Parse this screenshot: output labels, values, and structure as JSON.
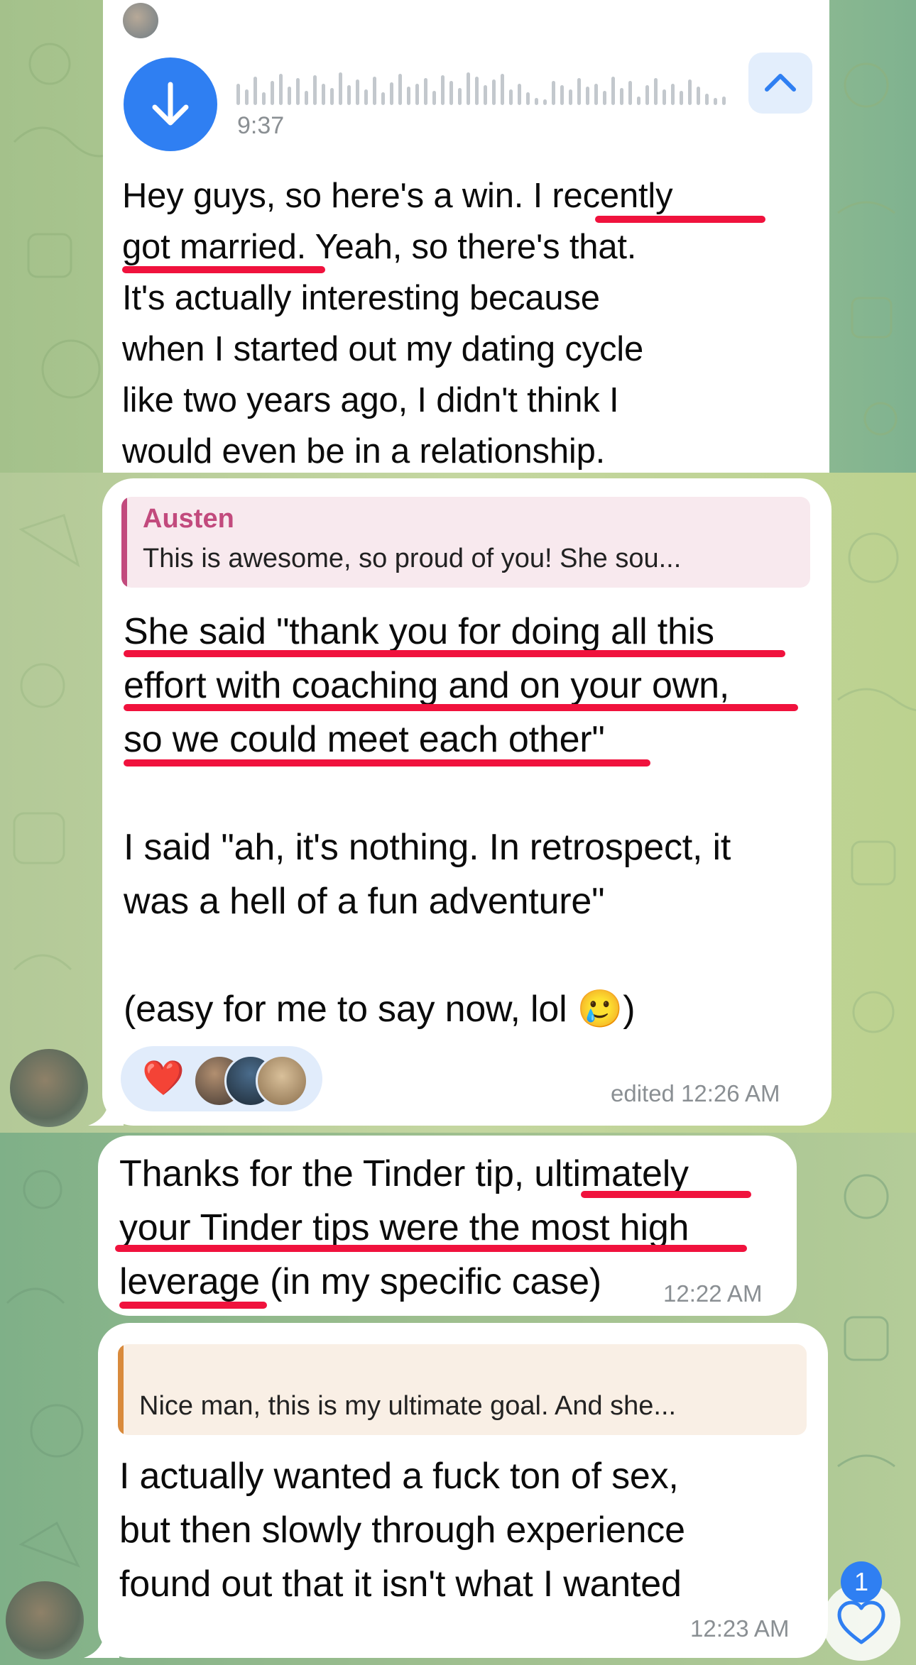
{
  "colors": {
    "accent": "#2f7ff2",
    "underline": "#f0123d",
    "austen": "#c24a7d",
    "quote2_bar": "#d98a3c"
  },
  "voice": {
    "duration": "9:37",
    "download_icon": "arrow-down-icon",
    "collapse_icon": "chevron-up-icon"
  },
  "message1": {
    "lines": [
      "Hey guys, so here's a win. I recently",
      "got married. Yeah, so there's that.",
      "It's actually interesting because",
      "when I started out my dating cycle",
      "like two years ago, I didn't think I",
      "would even be in a relationship."
    ]
  },
  "message2": {
    "reply_name": "Austen",
    "reply_text": "This is awesome, so proud of you! She sou...",
    "lines": [
      "She said \"thank you for doing all this",
      "effort with coaching and on your own,",
      "so we could meet each other\"",
      "",
      "I said \"ah, it's nothing. In retrospect, it",
      "was a hell of a fun adventure\"",
      "",
      "(easy for me to say now, lol 🥲)"
    ],
    "reaction_emoji": "❤️",
    "time": "edited 12:26 AM"
  },
  "message3": {
    "lines": [
      "Thanks for the Tinder tip, ultimately",
      "your Tinder tips were the most high",
      "leverage (in my specific case)"
    ],
    "time": "12:22 AM"
  },
  "message4": {
    "reply_text": "Nice man, this is my ultimate goal. And she...",
    "lines": [
      "I actually wanted a fuck ton of sex,",
      "but then slowly through experience",
      "found out that it isn't what I wanted"
    ],
    "time": "12:23 AM"
  },
  "reactions_button": {
    "count": "1",
    "icon": "heart-outline-icon"
  }
}
